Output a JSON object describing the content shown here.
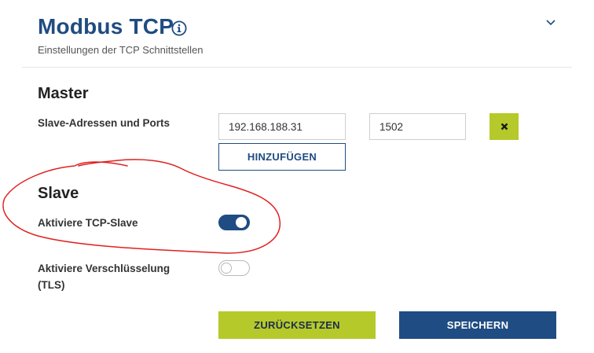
{
  "header": {
    "title": "Modbus TCP",
    "subtitle": "Einstellungen der TCP Schnittstellen",
    "info_icon": "info-icon",
    "collapse_icon": "chevron-down-icon"
  },
  "master": {
    "heading": "Master",
    "addresses_label": "Slave-Adressen und Ports",
    "address_value": "192.168.188.31",
    "port_value": "1502",
    "remove_icon": "close-icon",
    "add_label": "HINZUFÜGEN"
  },
  "slave": {
    "heading": "Slave",
    "tcp_slave_label": "Aktiviere TCP-Slave",
    "tcp_slave_enabled": true,
    "tls_label": "Aktiviere Verschlüsselung (TLS)",
    "tls_enabled": false
  },
  "actions": {
    "reset_label": "ZURÜCKSETZEN",
    "save_label": "SPEICHERN"
  },
  "colors": {
    "primary": "#1f4c82",
    "accent": "#b5c92b",
    "annotation": "#e02020"
  }
}
